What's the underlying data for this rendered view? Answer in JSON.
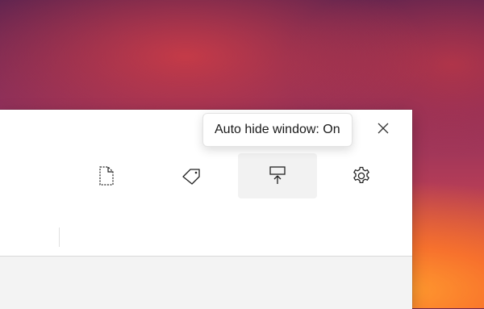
{
  "tooltip": {
    "text": "Auto hide window: On"
  },
  "toolbar": {
    "buttons": [
      {
        "icon": "new-page-icon",
        "active": false
      },
      {
        "icon": "tag-icon",
        "active": false
      },
      {
        "icon": "auto-hide-icon",
        "active": true
      },
      {
        "icon": "gear-icon",
        "active": false
      }
    ]
  },
  "window": {
    "close_icon": "close-icon"
  }
}
